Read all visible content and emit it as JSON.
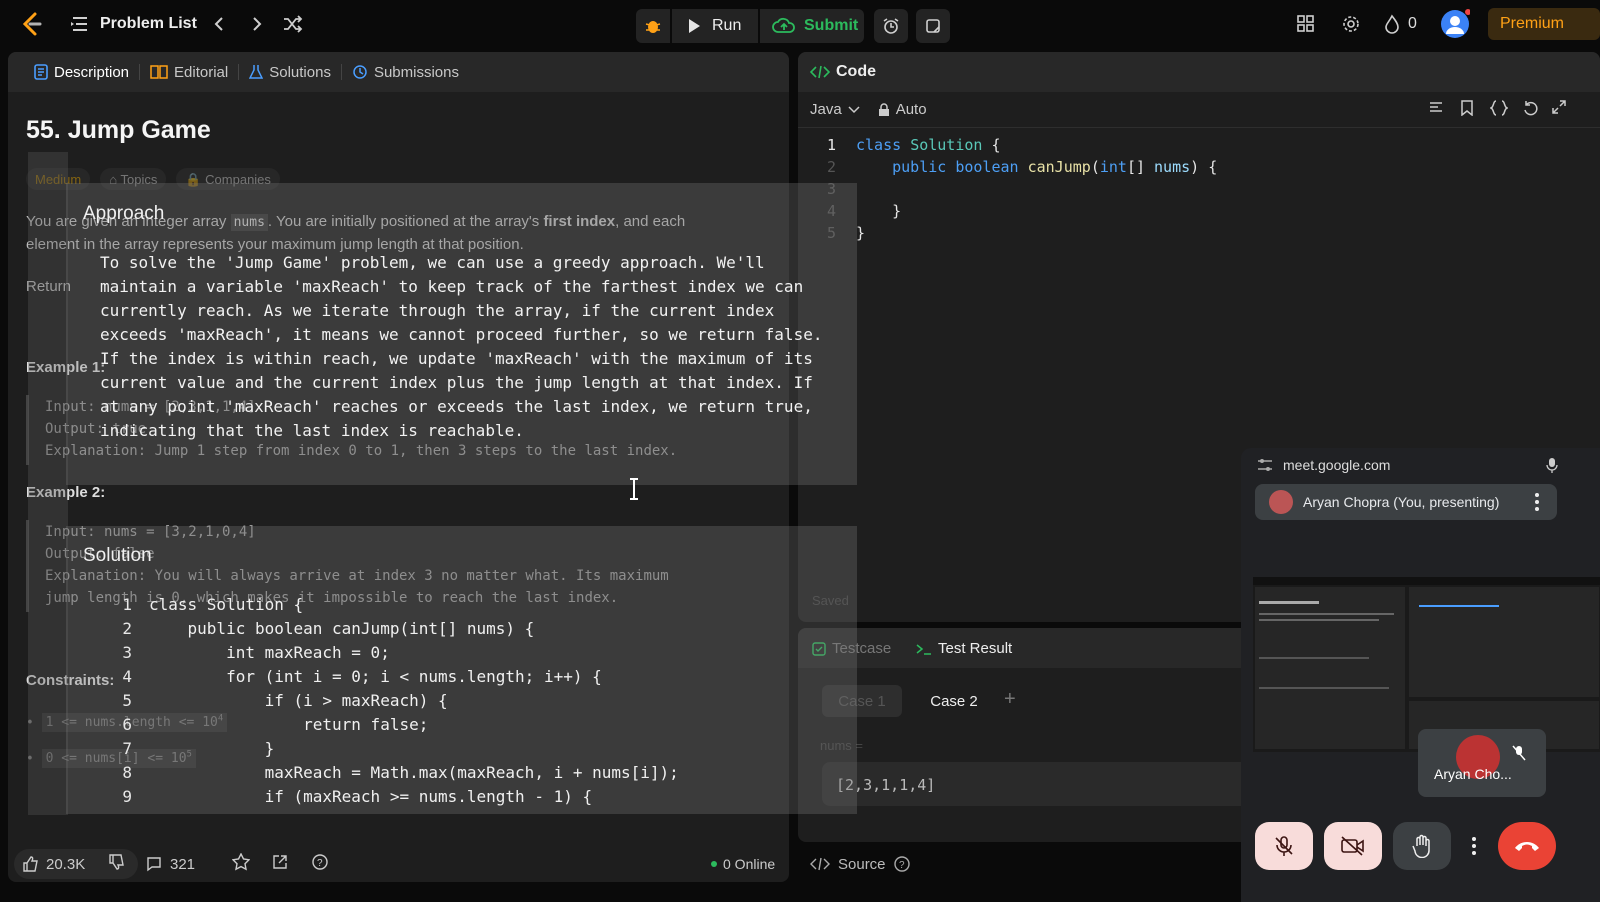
{
  "topbar": {
    "problem_list_label": "Problem List",
    "run_label": "Run",
    "submit_label": "Submit",
    "streak_count": "0",
    "premium_label": "Premium"
  },
  "left_panel": {
    "tabs": [
      {
        "label": "Description",
        "icon": "document-icon"
      },
      {
        "label": "Editorial",
        "icon": "book-icon"
      },
      {
        "label": "Solutions",
        "icon": "flask-icon"
      },
      {
        "label": "Submissions",
        "icon": "history-icon"
      }
    ],
    "title": "55. Jump Game",
    "difficulty": "Medium",
    "topics_label": "Topics",
    "companies_label": "Companies",
    "description_1a": "You are given an integer array ",
    "description_1code": "nums",
    "description_1b": ". You are initially positioned at the array's ",
    "description_1bold": "first index",
    "description_1c": ", and each",
    "description_2": "element in the array represents your maximum jump length at that position.",
    "description_3": "Return",
    "example1_title": "Example 1:",
    "example1_input": "Input: nums = [2,3,1,1,4]",
    "example1_output": "Output: true",
    "example1_explanation": "Explanation: Jump 1 step from index 0 to 1, then 3 steps to the last index.",
    "example2_title": "Example 2:",
    "example2_input": "Input: nums = [3,2,1,0,4]",
    "example2_output": "Output: false",
    "example2_explanation_1": "Explanation: You will always arrive at index 3 no matter what. Its maximum",
    "example2_explanation_2": "jump length is 0, which makes it impossible to reach the last index.",
    "constraints_title": "Constraints:",
    "constraint_1": "1 <= nums.length <= 10",
    "constraint_1_sup": "4",
    "constraint_2": "0 <= nums[i] <= 10",
    "constraint_2_sup": "5",
    "likes": "20.3K",
    "comments": "321",
    "online": "0 Online"
  },
  "approach_overlay": {
    "heading": "Approach",
    "lines": [
      "To solve the 'Jump Game' problem, we can use a greedy approach. We'll",
      "maintain a variable 'maxReach' to keep track of the farthest index we can",
      "currently reach. As we iterate through the array, if the current index",
      "exceeds 'maxReach', it means we cannot proceed further, so we return false.",
      "If the index is within reach, we update 'maxReach' with the maximum of its",
      "current value and the current index plus the jump length at that index. If",
      "at any point 'maxReach' reaches or exceeds the last index, we return true,",
      "indicating that the last index is reachable."
    ]
  },
  "solution_overlay": {
    "heading": "Solution",
    "lines": [
      {
        "n": "1",
        "code": "class Solution {"
      },
      {
        "n": "2",
        "code": "    public boolean canJump(int[] nums) {"
      },
      {
        "n": "3",
        "code": "        int maxReach = 0;"
      },
      {
        "n": "4",
        "code": "        for (int i = 0; i < nums.length; i++) {"
      },
      {
        "n": "5",
        "code": "            if (i > maxReach) {"
      },
      {
        "n": "6",
        "code": "                return false;"
      },
      {
        "n": "7",
        "code": "            }"
      },
      {
        "n": "8",
        "code": "            maxReach = Math.max(maxReach, i + nums[i]);"
      },
      {
        "n": "9",
        "code": "            if (maxReach >= nums.length - 1) {"
      }
    ]
  },
  "code_panel": {
    "title": "Code",
    "language": "Java",
    "auto_label": "Auto",
    "lines": [
      {
        "n": "1",
        "parts": [
          [
            "class ",
            "kw"
          ],
          [
            "Solution",
            "cls"
          ],
          [
            " {",
            "p"
          ]
        ]
      },
      {
        "n": "2",
        "parts": [
          [
            "    public ",
            "kw"
          ],
          [
            "boolean ",
            "kw"
          ],
          [
            "canJump",
            "fn"
          ],
          [
            "(",
            "p"
          ],
          [
            "int",
            "kw"
          ],
          [
            "[] ",
            "p"
          ],
          [
            "nums",
            "var"
          ],
          [
            ") {",
            "p"
          ]
        ]
      },
      {
        "n": "3",
        "parts": []
      },
      {
        "n": "4",
        "parts": [
          [
            "    }",
            "p"
          ]
        ]
      },
      {
        "n": "5",
        "parts": [
          [
            "}",
            "p"
          ]
        ]
      }
    ],
    "saved_label": "Saved"
  },
  "test_panel": {
    "testcase_tab": "Testcase",
    "result_tab": "Test Result",
    "case1": "Case 1",
    "case2": "Case 2",
    "nums_label": "nums =",
    "nums_value": "[2,3,1,1,4]",
    "source_label": "Source"
  },
  "meet": {
    "url": "meet.google.com",
    "presenter": "Aryan Chopra (You, presenting)",
    "tile_name": "Aryan Cho..."
  },
  "colors": {
    "accent_orange": "#ffa116",
    "submit_green": "#2cbb5d",
    "end_call_red": "#ea4335",
    "link_blue": "#4a9eff"
  }
}
